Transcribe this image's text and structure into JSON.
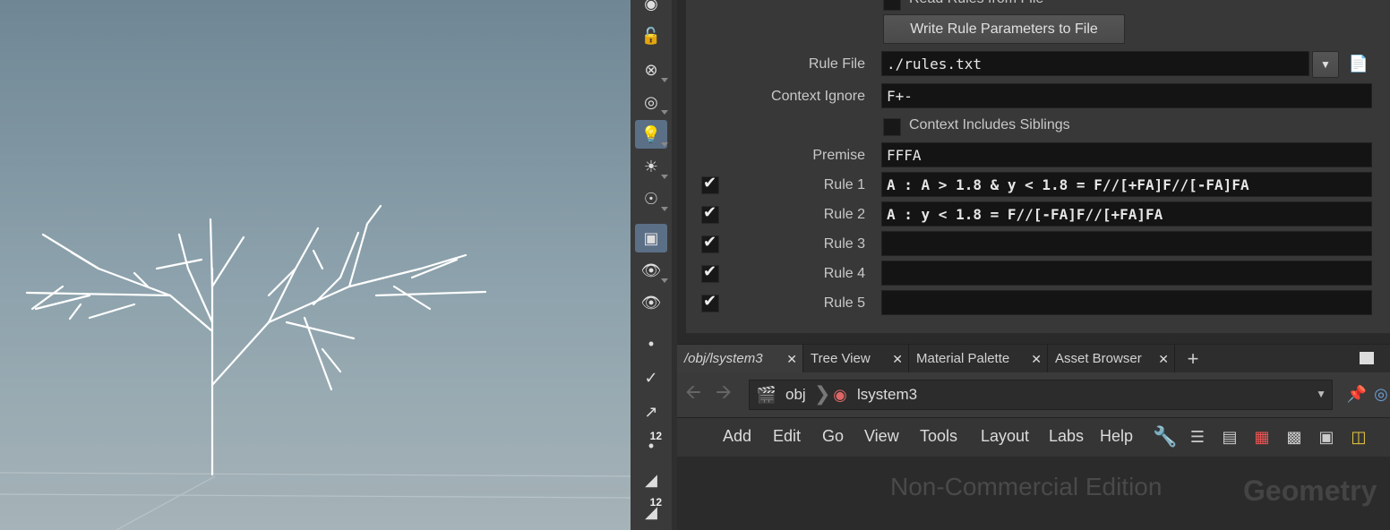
{
  "params": {
    "top_cut_label": "Read Rules from File",
    "write_button": "Write Rule Parameters to File",
    "rule_file_label": "Rule File",
    "rule_file_value": "./rules.txt",
    "context_ignore_label": "Context Ignore",
    "context_ignore_value": "F+-",
    "context_siblings_label": "Context Includes Siblings",
    "premise_label": "Premise",
    "premise_value": "FFFA",
    "rules": [
      {
        "label": "Rule 1",
        "value": "A : A > 1.8 & y < 1.8 = F//[+FA]F//[-FA]FA",
        "enabled": true
      },
      {
        "label": "Rule 2",
        "value": "A : y < 1.8 = F//[-FA]F//[+FA]FA",
        "enabled": true
      },
      {
        "label": "Rule 3",
        "value": "",
        "enabled": true
      },
      {
        "label": "Rule 4",
        "value": "",
        "enabled": true
      },
      {
        "label": "Rule 5",
        "value": "",
        "enabled": true
      }
    ]
  },
  "tabs": [
    {
      "label": "/obj/lsystem3"
    },
    {
      "label": "Tree View"
    },
    {
      "label": "Material Palette"
    },
    {
      "label": "Asset Browser"
    }
  ],
  "path": {
    "obj": "obj",
    "node": "lsystem3"
  },
  "menu": [
    "Add",
    "Edit",
    "Go",
    "View",
    "Tools",
    "Layout",
    "Labs",
    "Help"
  ],
  "network": {
    "watermark": "Non-Commercial Edition",
    "context": "Geometry"
  },
  "toolbar_badges": {
    "a": "12",
    "b": "12"
  },
  "colors": {
    "viewport_top": "#6f8795",
    "active_tool": "#5b6f87",
    "panel": "#383838",
    "field": "#141414"
  }
}
